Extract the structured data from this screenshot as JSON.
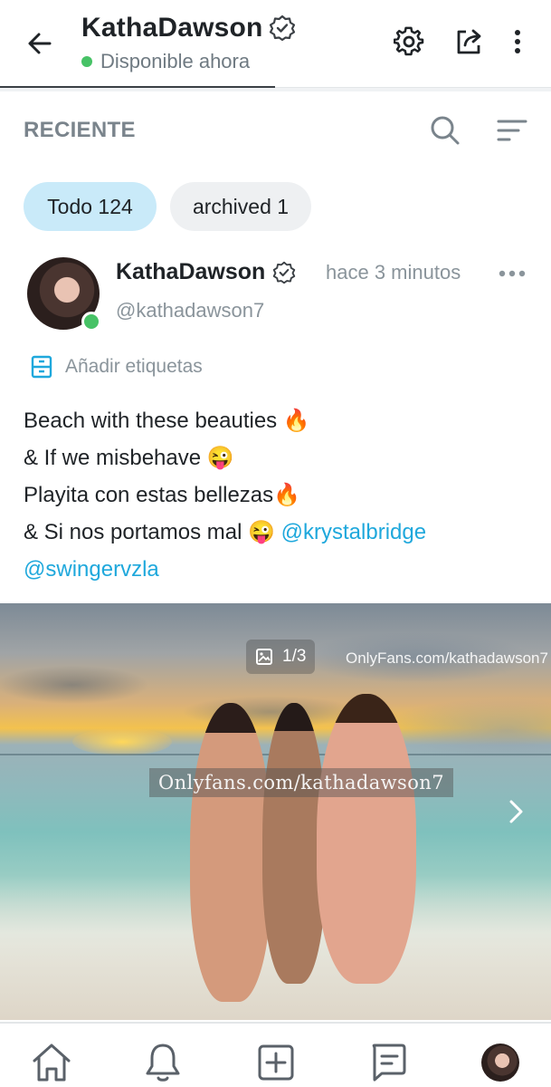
{
  "header": {
    "title": "KathaDawson",
    "status": "Disponible ahora",
    "icons": [
      "back-arrow-icon",
      "verified-badge-icon",
      "gear-icon",
      "share-icon",
      "more-vertical-icon"
    ]
  },
  "section": {
    "label": "RECIENTE",
    "icons": [
      "search-icon",
      "sort-icon"
    ]
  },
  "filters": [
    {
      "label": "Todo 124",
      "active": true
    },
    {
      "label": "archived 1",
      "active": false
    }
  ],
  "post": {
    "author": "KathaDawson",
    "handle": "@kathadawson7",
    "time": "hace 3 minutos",
    "tags_label": "Añadir etiquetas",
    "lines": [
      {
        "text": "Beach with these beauties 🔥",
        "mention": ""
      },
      {
        "text": "& If we misbehave 😜",
        "mention": ""
      },
      {
        "text": "Playita con estas bellezas🔥",
        "mention": ""
      },
      {
        "text": "& Si nos portamos mal 😜 ",
        "mention": "@krystalbridge"
      },
      {
        "text": "",
        "mention": "@swingervzla"
      }
    ],
    "media": {
      "watermark": "Onlyfans.com/kathadawson7",
      "counter": "1/3",
      "corner_watermark": "OnlyFans.com/kathadawson7"
    }
  },
  "bottom_nav": [
    "home-icon",
    "bell-icon",
    "add-post-icon",
    "messages-icon",
    "profile-avatar"
  ],
  "colors": {
    "accent": "#1fa8dc",
    "online": "#47c266",
    "chip_active": "#c9eaf9",
    "chip_inactive": "#eef0f2"
  }
}
